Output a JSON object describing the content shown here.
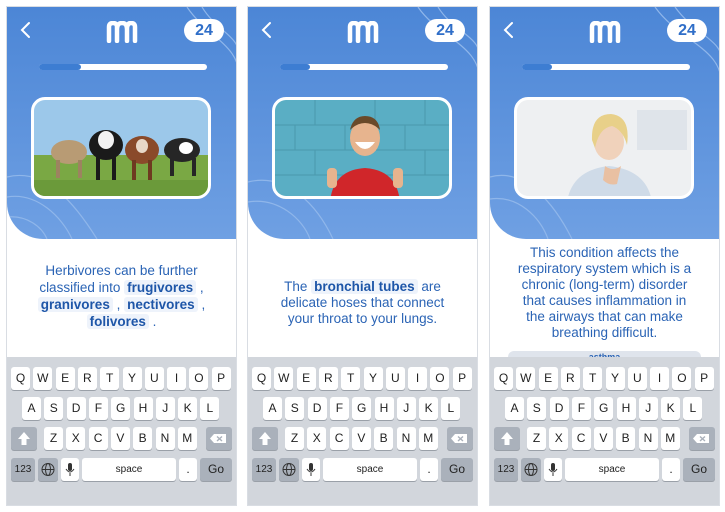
{
  "common": {
    "back_glyph": "‹",
    "counter": "24",
    "accent": "#2b64b5",
    "hero_color": "#5b92dc"
  },
  "screens": [
    {
      "progress": 0.25,
      "photo": "cows-photo",
      "text": {
        "l1": "Herbivores can be further",
        "l2a": "classified into",
        "t1": "frugivores",
        "l2b": ",",
        "t2": "granivores",
        "s2": ",",
        "t3": "nectivores",
        "s3": ",",
        "t4": "folivores",
        "s4": "."
      }
    },
    {
      "progress": 0.18,
      "photo": "smiling-man-photo",
      "text": {
        "a": "The",
        "t1": "bronchial tubes",
        "b": "are",
        "l2": "delicate hoses that connect",
        "l3": "your throat to your lungs."
      }
    },
    {
      "progress": 0.18,
      "photo": "coughing-woman-photo",
      "text": {
        "l1": "This condition affects the",
        "l2": "respiratory system which is a",
        "l3": "chronic (long-term) disorder",
        "l4": "that causes inflammation in",
        "l5": "the airways that can make",
        "l6": "breathing difficult."
      },
      "hint": "asthma"
    }
  ],
  "keyboard": {
    "row1": [
      "Q",
      "W",
      "E",
      "R",
      "T",
      "Y",
      "U",
      "I",
      "O",
      "P"
    ],
    "row2": [
      "A",
      "S",
      "D",
      "F",
      "G",
      "H",
      "J",
      "K",
      "L"
    ],
    "row3": [
      "Z",
      "X",
      "C",
      "V",
      "B",
      "N",
      "M"
    ],
    "numbers": "123",
    "globe": "globe-icon",
    "mic": "mic-icon",
    "space": "space",
    "period": ".",
    "go": "Go"
  }
}
